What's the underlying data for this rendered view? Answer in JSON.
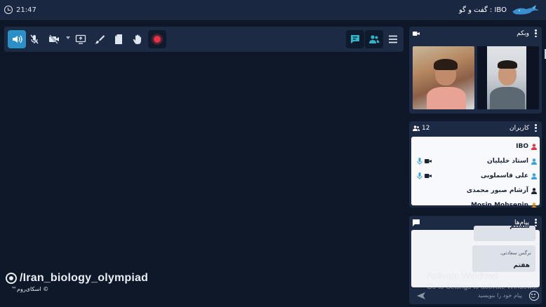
{
  "topbar": {
    "time": "21:47",
    "room_title": "IBO : گفت و گو",
    "logo_icon": "whale-logo-icon"
  },
  "toolbar": {
    "buttons": [
      {
        "name": "speaker-button",
        "icon": "speaker-icon",
        "active": true
      },
      {
        "name": "mic-button",
        "icon": "mic-off-icon",
        "active": false
      },
      {
        "name": "camera-button",
        "icon": "camera-off-icon",
        "active": false
      },
      {
        "name": "screen-share-button",
        "icon": "screen-share-icon",
        "active": false
      },
      {
        "name": "draw-button",
        "icon": "brush-icon",
        "active": false
      },
      {
        "name": "file-button",
        "icon": "file-icon",
        "active": false
      },
      {
        "name": "raise-hand-button",
        "icon": "hand-icon",
        "active": false
      },
      {
        "name": "record-button",
        "icon": "record-icon",
        "active": false
      }
    ],
    "right_buttons": [
      "chat-toggle-icon",
      "users-toggle-icon",
      "menu-icon"
    ]
  },
  "webcam_panel": {
    "title": "وبکم"
  },
  "users_panel": {
    "title": "کاربران",
    "count": "12",
    "users": [
      {
        "name": "IBO",
        "icon_color": "#e2334a",
        "mic": false,
        "cam": false
      },
      {
        "name": "استاد خلیلیان",
        "icon_color": "#3aa0d8",
        "mic": true,
        "cam": true
      },
      {
        "name": "علی قاسملوبی",
        "icon_color": "#3aa0d8",
        "mic": true,
        "cam": true
      },
      {
        "name": "آرشام صبور محمدی",
        "icon_color": "#1b2433",
        "mic": false,
        "cam": false
      },
      {
        "name": "Mosin Mohsenin",
        "icon_color": "#e0a020",
        "mic": false,
        "cam": false
      }
    ]
  },
  "messages_panel": {
    "title": "پیام‌ها",
    "partial_text": "سستم",
    "sender": "نرگس سعادتی.",
    "text": "هفتم",
    "input_placeholder": "پیام خود را بنویسید"
  },
  "overlay": {
    "watermark": "/Iran_biology_olympiad",
    "brand": "© اسکای‌روم™",
    "activate_title": "Activate Windows",
    "activate_sub": "Go to Settings to activate Windows."
  }
}
